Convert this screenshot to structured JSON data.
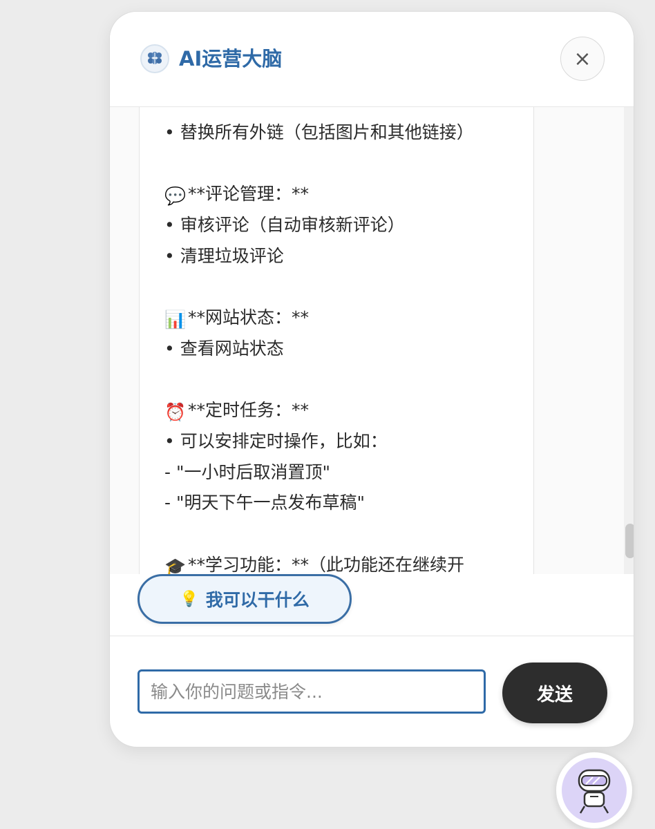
{
  "header": {
    "title": "AI运营大脑",
    "logo_icon": "brain-icon",
    "close_label": "×"
  },
  "chat": {
    "lines": [
      {
        "icon": "",
        "text": "• 替换所有外链（包括图片和其他链接）"
      },
      {
        "icon": "",
        "text": ""
      },
      {
        "icon": "speech-bubble-icon",
        "glyph": "💬",
        "text": "**评论管理：**"
      },
      {
        "icon": "",
        "text": "• 审核评论（自动审核新评论）"
      },
      {
        "icon": "",
        "text": "• 清理垃圾评论"
      },
      {
        "icon": "",
        "text": ""
      },
      {
        "icon": "bar-chart-icon",
        "glyph": "📊",
        "text": "**网站状态：**"
      },
      {
        "icon": "",
        "text": "• 查看网站状态"
      },
      {
        "icon": "",
        "text": ""
      },
      {
        "icon": "alarm-clock-icon",
        "glyph": "⏰",
        "text": "**定时任务：**"
      },
      {
        "icon": "",
        "text": "• 可以安排定时操作，比如："
      },
      {
        "icon": "",
        "text": "- \"一小时后取消置顶\""
      },
      {
        "icon": "",
        "text": "- \"明天下午一点发布草稿\""
      },
      {
        "icon": "",
        "text": ""
      },
      {
        "icon": "graduation-cap-icon",
        "glyph": "🎓",
        "text": "**学习功能：**（此功能还在继续开"
      }
    ]
  },
  "suggestion": {
    "label": "我可以干什么",
    "icon": "lightbulb-icon"
  },
  "composer": {
    "placeholder": "输入你的问题或指令...",
    "send_label": "发送"
  },
  "colors": {
    "accent": "#2f6aa7",
    "send_bg": "#2d2d2d",
    "avatar_bg": "#dcd4f7"
  }
}
